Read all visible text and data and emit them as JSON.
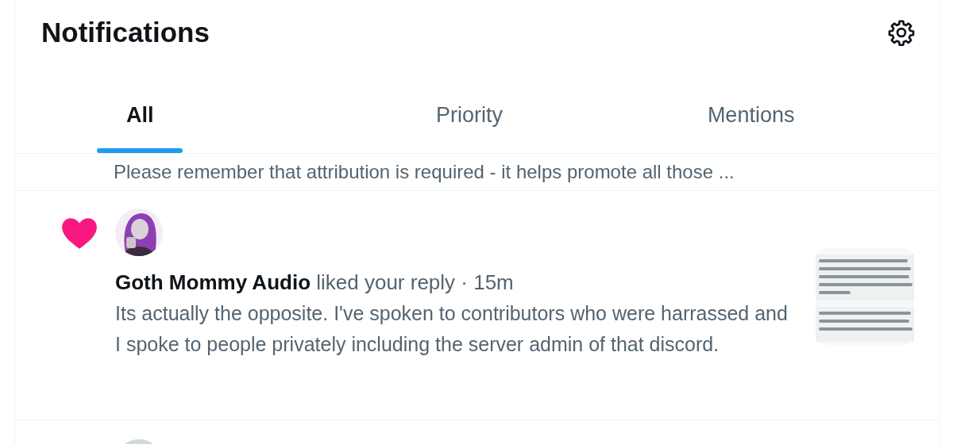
{
  "header": {
    "title": "Notifications"
  },
  "tabs": [
    {
      "label": "All",
      "selected": true
    },
    {
      "label": "Priority",
      "selected": false
    },
    {
      "label": "Mentions",
      "selected": false
    }
  ],
  "notifications": [
    {
      "kind": "snippet",
      "text": "Please remember that attribution is required - it helps promote all those ..."
    },
    {
      "kind": "like",
      "name": "Goth Mommy Audio",
      "action": "liked your reply",
      "separator": "·",
      "time": "15m",
      "text": "Its actually the opposite. I've spoken to contributors who were harrassed and I spoke to people privately including the server admin of that discord."
    },
    {
      "kind": "partial"
    }
  ]
}
